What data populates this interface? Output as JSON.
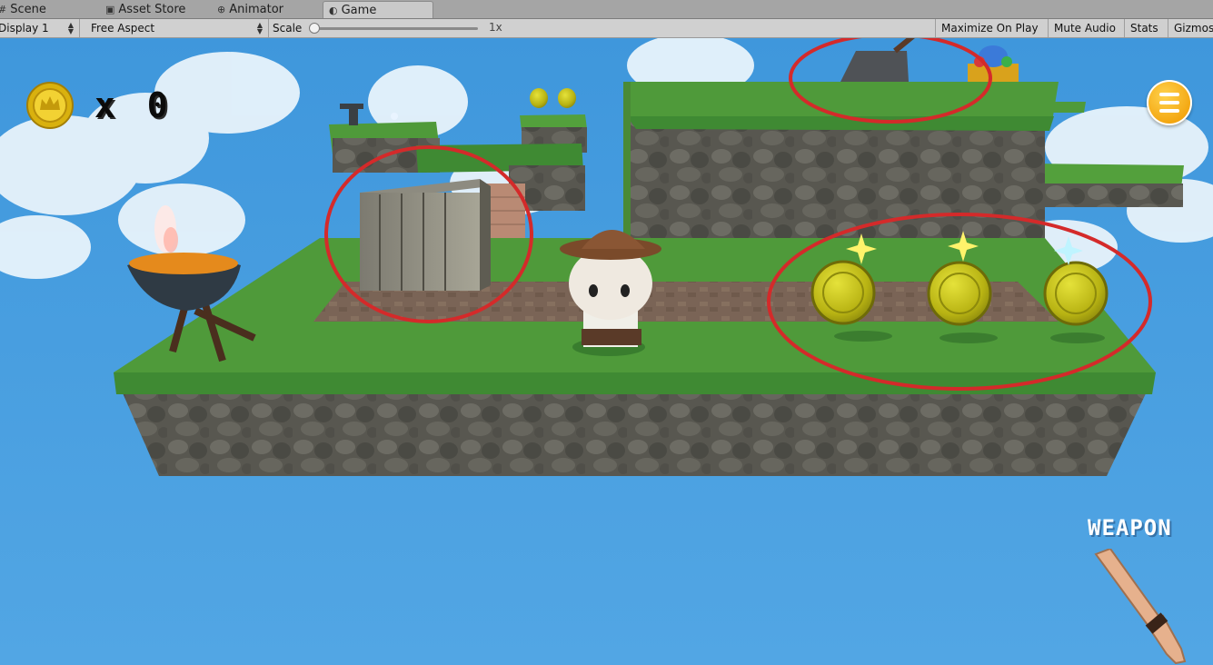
{
  "tabs": [
    {
      "label": "Scene",
      "icon": "scene-icon"
    },
    {
      "label": "Asset Store",
      "icon": "store-icon"
    },
    {
      "label": "Animator",
      "icon": "animator-icon"
    },
    {
      "label": "Game",
      "icon": "game-icon",
      "active": true
    }
  ],
  "toolbar": {
    "display": "Display 1",
    "aspect": "Free Aspect",
    "scale_label": "Scale",
    "scale_value": "1x",
    "maximize_on_play": "Maximize On Play",
    "mute_audio": "Mute Audio",
    "stats": "Stats",
    "gizmos": "Gizmos"
  },
  "hud": {
    "coin_count_text": "x 0",
    "weapon_label": "WEAPON",
    "menu_icon": "hamburger-icon"
  },
  "colors": {
    "sky": "#4ea3e2",
    "grass": "#4f9a3a",
    "rock": "#5b5a52",
    "annotation": "#d42a2a",
    "coin": "#c9c41a",
    "menu_button": "#f3a50f"
  }
}
